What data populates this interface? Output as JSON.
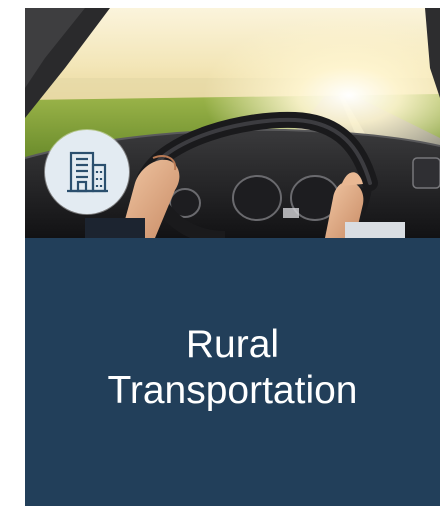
{
  "card": {
    "title_line1": "Rural",
    "title_line2": "Transportation",
    "panel_color": "#223f5a",
    "badge_color": "#e3ebf2",
    "icon": "office-building-icon",
    "image": "driver-hands-on-steering-wheel-photo"
  }
}
